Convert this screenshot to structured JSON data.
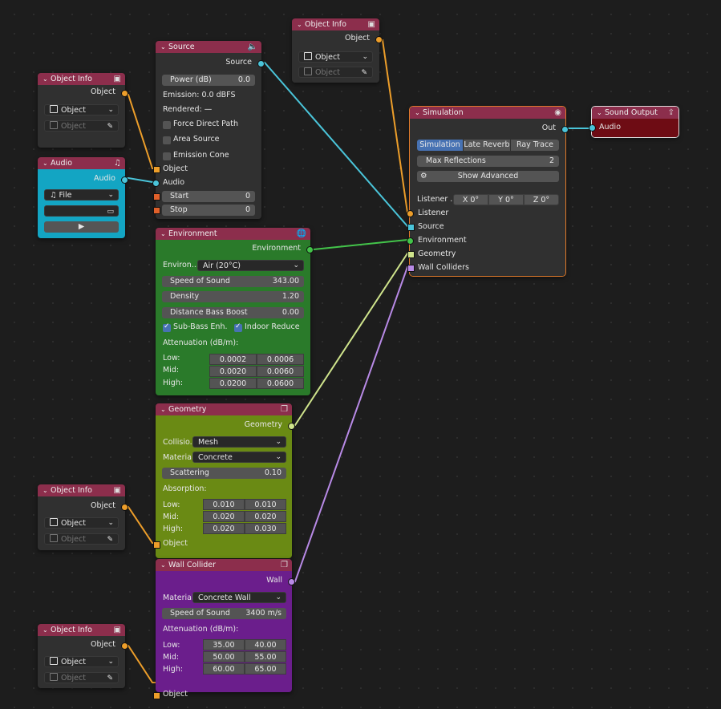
{
  "colors": {
    "object_socket": "#ed9e2a",
    "audio_socket": "#4ac4d9",
    "env_socket": "#43c44a",
    "geo_socket": "#cfe48c",
    "wall_socket": "#b88ae6",
    "objinfo_header": "#8c2e4c",
    "audio_body": "#13a5c3",
    "env_body": "#2a7a2a",
    "geo_body": "#6a8a14",
    "wall_body": "#6b1e8c",
    "out_body": "#6e0c14"
  },
  "obj1": {
    "title": "Object Info",
    "out": "Object",
    "dd": "Object",
    "picker": "Object"
  },
  "obj2": {
    "title": "Object Info",
    "out": "Object",
    "dd": "Object",
    "picker": "Object"
  },
  "obj3": {
    "title": "Object Info",
    "out": "Object",
    "dd": "Object",
    "picker": "Object"
  },
  "obj4": {
    "title": "Object Info",
    "out": "Object",
    "dd": "Object",
    "picker": "Object"
  },
  "audio": {
    "title": "Audio",
    "out": "Audio",
    "dd": "File",
    "file_path": ""
  },
  "source": {
    "title": "Source",
    "out": "Source",
    "power_label": "Power (dB)",
    "power_value": "0.0",
    "emission": "Emission: 0.0 dBFS",
    "rendered": "Rendered: —",
    "force_direct": "Force Direct Path",
    "area_source": "Area Source",
    "emission_cone": "Emission Cone",
    "in_object": "Object",
    "in_audio": "Audio",
    "start_label": "Start",
    "start_value": "0",
    "stop_label": "Stop",
    "stop_value": "0"
  },
  "env": {
    "title": "Environment",
    "out": "Environment",
    "env_label": "Environ...",
    "env_value": "Air (20°C)",
    "sos_label": "Speed of Sound",
    "sos_value": "343.00",
    "den_label": "Density",
    "den_value": "1.20",
    "dbb_label": "Distance Bass Boost",
    "dbb_value": "0.00",
    "sub_bass": "Sub-Bass Enh.",
    "indoor": "Indoor Reduce",
    "att_label": "Attenuation (dB/m):",
    "rows": [
      {
        "label": "Low:",
        "a": "0.0002",
        "b": "0.0006"
      },
      {
        "label": "Mid:",
        "a": "0.0020",
        "b": "0.0060"
      },
      {
        "label": "High:",
        "a": "0.0200",
        "b": "0.0600"
      }
    ]
  },
  "geo": {
    "title": "Geometry",
    "out": "Geometry",
    "coll_label": "Collisio...",
    "coll_value": "Mesh",
    "mat_label": "Material:",
    "mat_value": "Concrete",
    "scat_label": "Scattering",
    "scat_value": "0.10",
    "abs_label": "Absorption:",
    "rows": [
      {
        "label": "Low:",
        "a": "0.010",
        "b": "0.010"
      },
      {
        "label": "Mid:",
        "a": "0.020",
        "b": "0.020"
      },
      {
        "label": "High:",
        "a": "0.020",
        "b": "0.030"
      }
    ],
    "in_object": "Object"
  },
  "wall": {
    "title": "Wall Collider",
    "out": "Wall",
    "mat_label": "Material:",
    "mat_value": "Concrete Wall",
    "sos_label": "Speed of Sound",
    "sos_value": "3400 m/s",
    "att_label": "Attenuation (dB/m):",
    "rows": [
      {
        "label": "Low:",
        "a": "35.00",
        "b": "40.00"
      },
      {
        "label": "Mid:",
        "a": "50.00",
        "b": "55.00"
      },
      {
        "label": "High:",
        "a": "60.00",
        "b": "65.00"
      }
    ],
    "in_object": "Object"
  },
  "sim": {
    "title": "Simulation",
    "out": "Out",
    "tabs": [
      "Simulation",
      "Late Reverb",
      "Ray Trace"
    ],
    "maxref_label": "Max Reflections",
    "maxref_value": "2",
    "show_adv": "Show Advanced",
    "listener_rot_label": "Listener ...",
    "x_label": "X",
    "x_value": "0°",
    "y_label": "Y",
    "y_value": "0°",
    "z_label": "Z",
    "z_value": "0°",
    "in_listener": "Listener",
    "in_source": "Source",
    "in_env": "Environment",
    "in_geo": "Geometry",
    "in_wall": "Wall Colliders"
  },
  "soundout": {
    "title": "Sound Output",
    "in_audio": "Audio"
  }
}
